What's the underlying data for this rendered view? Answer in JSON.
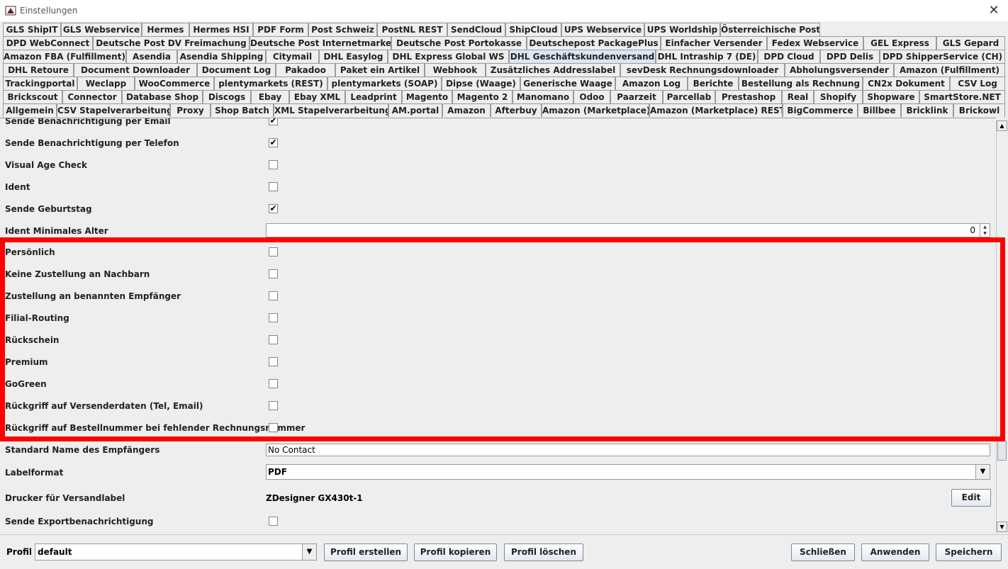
{
  "window": {
    "title": "Einstellungen"
  },
  "tabs": {
    "row1": [
      "GLS ShipIT",
      "GLS Webservice",
      "Hermes",
      "Hermes HSI",
      "PDF Form",
      "Post Schweiz",
      "PostNL REST",
      "SendCloud",
      "ShipCloud",
      "UPS Webservice",
      "UPS Worldship",
      "Österreichische Post"
    ],
    "row2": [
      "DPD WebConnect",
      "Deutsche Post DV Freimachung",
      "Deutsche Post Internetmarke",
      "Deutsche Post Portokasse",
      "Deutschepost PackagePlus",
      "Einfacher Versender",
      "Fedex Webservice",
      "GEL Express",
      "GLS Gepard"
    ],
    "row3": [
      "Amazon FBA (Fulfillment)",
      "Asendia",
      "Asendia Shipping",
      "Citymail",
      "DHL Easylog",
      "DHL Express Global WS",
      "DHL Geschäftskundenversand",
      "DHL Intraship 7 (DE)",
      "DPD Cloud",
      "DPD Delis",
      "DPD ShipperService (CH)"
    ],
    "row4": [
      "DHL Retoure",
      "Document Downloader",
      "Document Log",
      "Pakadoo",
      "Paket ein Artikel",
      "Webhook",
      "Zusätzliches Addresslabel",
      "sevDesk Rechnungsdownloader",
      "Abholungsversender",
      "Amazon (Fulfillment)"
    ],
    "row5": [
      "Trackingportal",
      "Weclapp",
      "WooCommerce",
      "plentymarkets (REST)",
      "plentymarkets (SOAP)",
      "Dipse (Waage)",
      "Generische Waage",
      "Amazon Log",
      "Berichte",
      "Bestellung als Rechnung",
      "CN2x Dokument",
      "CSV Log"
    ],
    "row6": [
      "Brickscout",
      "Connector",
      "Database Shop",
      "Discogs",
      "Ebay",
      "Ebay XML",
      "Leadprint",
      "Magento",
      "Magento 2",
      "Manomano",
      "Odoo",
      "Paarzeit",
      "Parcellab",
      "Prestashop",
      "Real",
      "Shopify",
      "Shopware",
      "SmartStore.NET"
    ],
    "row7": [
      "Allgemein",
      "CSV Stapelverarbeitung",
      "Proxy",
      "Shop Batch",
      "XML Stapelverarbeitung",
      "AM.portal",
      "Amazon",
      "Afterbuy",
      "Amazon (Marketplace)",
      "Amazon (Marketplace) REST",
      "BigCommerce",
      "Billbee",
      "Bricklink",
      "Brickowl"
    ],
    "selected": "DHL Geschäftskundenversand"
  },
  "settings": {
    "r0": {
      "label": "Sende Benachrichtigung per Email",
      "checked": true
    },
    "r1": {
      "label": "Sende Benachrichtigung per Telefon",
      "checked": true
    },
    "r2": {
      "label": "Visual Age Check",
      "checked": false
    },
    "r3": {
      "label": "Ident",
      "checked": false
    },
    "r4": {
      "label": "Sende Geburtstag",
      "checked": true
    },
    "r5": {
      "label": "Ident Minimales Alter",
      "value": "0"
    },
    "r6": {
      "label": "Persönlich",
      "checked": false
    },
    "r7": {
      "label": "Keine Zustellung an Nachbarn",
      "checked": false
    },
    "r8": {
      "label": "Zustellung an benannten Empfänger",
      "checked": false
    },
    "r9": {
      "label": "Filial-Routing",
      "checked": false
    },
    "r10": {
      "label": "Rückschein",
      "checked": false
    },
    "r11": {
      "label": "Premium",
      "checked": false
    },
    "r12": {
      "label": "GoGreen",
      "checked": false
    },
    "r13": {
      "label": "Rückgriff auf Versenderdaten (Tel, Email)",
      "checked": false
    },
    "r14": {
      "label": "Rückgriff auf Bestellnummer bei fehlender Rechnungsnummer",
      "checked": false
    },
    "r15": {
      "label": "Standard Name des Empfängers",
      "value": "No Contact"
    },
    "r16": {
      "label": "Labelformat",
      "value": "PDF"
    },
    "r17": {
      "label": "Drucker für Versandlabel",
      "value": "ZDesigner GX430t-1",
      "button": "Edit"
    },
    "r18": {
      "label": "Sende Exportbenachrichtigung",
      "checked": false
    }
  },
  "bottom": {
    "profile_label": "Profil",
    "profile_value": "default",
    "create": "Profil erstellen",
    "copy": "Profil kopieren",
    "delete": "Profil löschen",
    "close": "Schließen",
    "apply": "Anwenden",
    "save": "Speichern"
  },
  "colors": {
    "highlight": "#ff0000",
    "selected_tab": "#dbe6f4"
  },
  "icons": {
    "app": "app-icon",
    "close": "close-icon",
    "check": "check-icon",
    "dropdown": "chevron-down-icon"
  }
}
